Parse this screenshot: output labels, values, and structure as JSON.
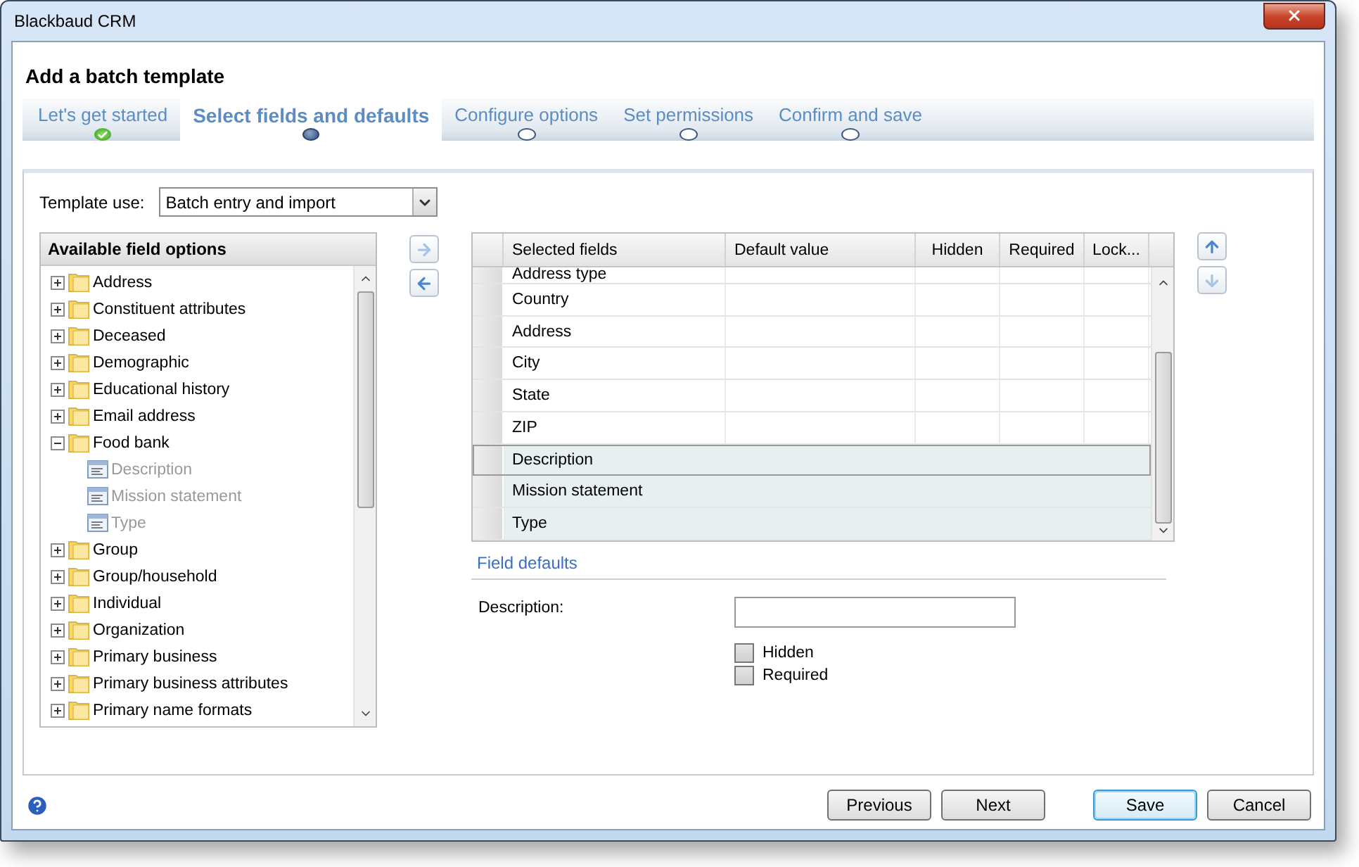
{
  "window": {
    "title": "Blackbaud CRM"
  },
  "dialog": {
    "title": "Add a batch template"
  },
  "steps": [
    {
      "label": "Let's get started",
      "kind": "done",
      "selected": false
    },
    {
      "label": "Select fields and defaults",
      "kind": "current",
      "selected": true
    },
    {
      "label": "Configure options",
      "kind": "todo",
      "selected": false
    },
    {
      "label": "Set permissions",
      "kind": "todo",
      "selected": false
    },
    {
      "label": "Confirm and save",
      "kind": "todo",
      "selected": false
    }
  ],
  "template_use": {
    "label": "Template use:",
    "value": "Batch entry and import"
  },
  "available_fields": {
    "title": "Available field options",
    "items": [
      {
        "label": "Address",
        "kind": "folder",
        "expanded": false
      },
      {
        "label": "Constituent attributes",
        "kind": "folder",
        "expanded": false
      },
      {
        "label": "Deceased",
        "kind": "folder",
        "expanded": false
      },
      {
        "label": "Demographic",
        "kind": "folder",
        "expanded": false
      },
      {
        "label": "Educational history",
        "kind": "folder",
        "expanded": false
      },
      {
        "label": "Email address",
        "kind": "folder",
        "expanded": false
      },
      {
        "label": "Food bank",
        "kind": "folder",
        "expanded": true,
        "children": [
          {
            "label": "Description",
            "kind": "field",
            "disabled": true
          },
          {
            "label": "Mission statement",
            "kind": "field",
            "disabled": true
          },
          {
            "label": "Type",
            "kind": "field",
            "disabled": true
          }
        ]
      },
      {
        "label": "Group",
        "kind": "folder",
        "expanded": false
      },
      {
        "label": "Group/household",
        "kind": "folder",
        "expanded": false
      },
      {
        "label": "Individual",
        "kind": "folder",
        "expanded": false
      },
      {
        "label": "Organization",
        "kind": "folder",
        "expanded": false
      },
      {
        "label": "Primary business",
        "kind": "folder",
        "expanded": false
      },
      {
        "label": "Primary business attributes",
        "kind": "folder",
        "expanded": false
      },
      {
        "label": "Primary name formats",
        "kind": "folder",
        "expanded": false
      }
    ]
  },
  "selected_fields": {
    "columns": [
      "Selected fields",
      "Default value",
      "Hidden",
      "Required",
      "Lock..."
    ],
    "rows": [
      {
        "field": "Address type",
        "selected": false,
        "highlighted": false,
        "kind": "partial"
      },
      {
        "field": "Country",
        "selected": false,
        "highlighted": false,
        "kind": "full"
      },
      {
        "field": "Address",
        "selected": false,
        "highlighted": false,
        "kind": "full"
      },
      {
        "field": "City",
        "selected": false,
        "highlighted": false,
        "kind": "full"
      },
      {
        "field": "State",
        "selected": false,
        "highlighted": false,
        "kind": "full"
      },
      {
        "field": "ZIP",
        "selected": false,
        "highlighted": false,
        "kind": "full"
      },
      {
        "field": "Description",
        "selected": true,
        "highlighted": true,
        "kind": "full"
      },
      {
        "field": "Mission statement",
        "selected": false,
        "highlighted": true,
        "kind": "full"
      },
      {
        "field": "Type",
        "selected": false,
        "highlighted": true,
        "kind": "full"
      }
    ]
  },
  "field_defaults": {
    "title": "Field defaults",
    "label": "Description:",
    "options": [
      {
        "label": "Hidden",
        "checked": false
      },
      {
        "label": "Required",
        "checked": false
      }
    ]
  },
  "nav_buttons": [
    {
      "label": "Previous",
      "default": false
    },
    {
      "label": "Next",
      "default": false
    }
  ],
  "action_buttons": [
    {
      "label": "Save",
      "default": true
    },
    {
      "label": "Cancel",
      "default": false
    }
  ]
}
